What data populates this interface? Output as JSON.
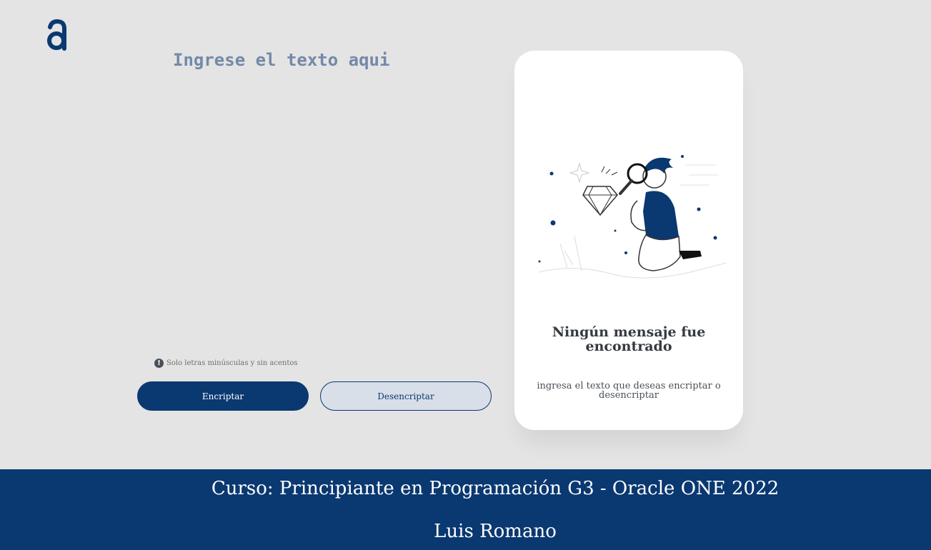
{
  "logo": {
    "icon": "alura-logo-icon",
    "color": "#0a3871"
  },
  "input": {
    "placeholder": "Ingrese el texto aqui",
    "value": ""
  },
  "hint": {
    "icon": "info-icon",
    "text": "Solo letras minúsculas y sin acentos"
  },
  "buttons": {
    "encrypt_label": "Encriptar",
    "decrypt_label": "Desencriptar"
  },
  "output_card": {
    "illustration": "boy-with-magnifying-glass-illustration",
    "title": "Ningún mensaje fue encontrado",
    "text": "ingresa el texto que deseas encriptar o desencriptar"
  },
  "footer": {
    "course": "Curso: Principiante en Programación G3 - Oracle ONE 2022",
    "author": "Luis Romano"
  },
  "colors": {
    "accent": "#0a3871",
    "background": "#e4e4e4",
    "card": "#ffffff"
  }
}
